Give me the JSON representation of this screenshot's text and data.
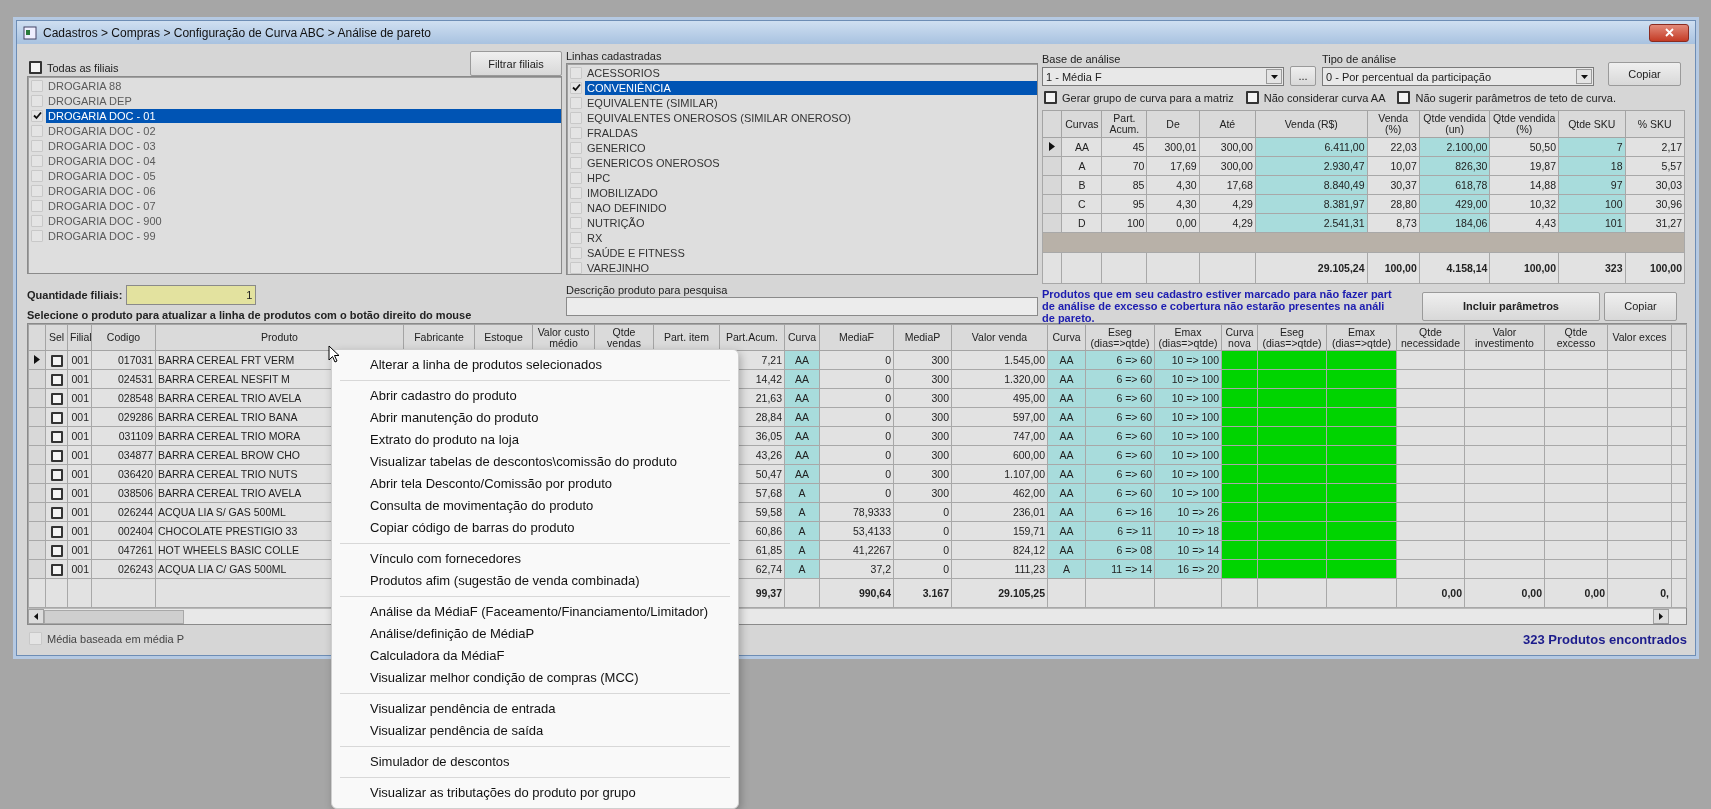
{
  "window": {
    "title": "Cadastros > Compras > Configuração de Curva ABC > Análise de pareto"
  },
  "filiais": {
    "all_label": "Todas as filiais",
    "all_checked": false,
    "filter_button": "Filtrar filiais",
    "items": [
      {
        "label": "DROGARIA 88",
        "checked": false,
        "selected": false
      },
      {
        "label": "DROGARIA DEP",
        "checked": false,
        "selected": false
      },
      {
        "label": "DROGARIA DOC - 01",
        "checked": true,
        "selected": true
      },
      {
        "label": "DROGARIA DOC - 02",
        "checked": false,
        "selected": false
      },
      {
        "label": "DROGARIA DOC - 03",
        "checked": false,
        "selected": false
      },
      {
        "label": "DROGARIA DOC - 04",
        "checked": false,
        "selected": false
      },
      {
        "label": "DROGARIA DOC - 05",
        "checked": false,
        "selected": false
      },
      {
        "label": "DROGARIA DOC - 06",
        "checked": false,
        "selected": false
      },
      {
        "label": "DROGARIA DOC - 07",
        "checked": false,
        "selected": false
      },
      {
        "label": "DROGARIA DOC - 900",
        "checked": false,
        "selected": false
      },
      {
        "label": "DROGARIA DOC - 99",
        "checked": false,
        "selected": false
      }
    ],
    "count_label": "Quantidade filiais:",
    "count_value": "1",
    "hint": "Selecione o produto para atualizar a linha de produtos com o botão direito do mouse"
  },
  "linhas": {
    "label": "Linhas cadastradas",
    "items": [
      {
        "label": "ACESSORIOS",
        "checked": false,
        "selected": false
      },
      {
        "label": "CONVENIÊNCIA",
        "checked": true,
        "selected": true
      },
      {
        "label": "EQUIVALENTE (SIMILAR)",
        "checked": false,
        "selected": false
      },
      {
        "label": "EQUIVALENTES ONEROSOS (SIMILAR ONEROSO)",
        "checked": false,
        "selected": false
      },
      {
        "label": "FRALDAS",
        "checked": false,
        "selected": false
      },
      {
        "label": "GENERICO",
        "checked": false,
        "selected": false
      },
      {
        "label": "GENERICOS ONEROSOS",
        "checked": false,
        "selected": false
      },
      {
        "label": "HPC",
        "checked": false,
        "selected": false
      },
      {
        "label": "IMOBILIZADO",
        "checked": false,
        "selected": false
      },
      {
        "label": "NAO DEFINIDO",
        "checked": false,
        "selected": false
      },
      {
        "label": "NUTRIÇÃO",
        "checked": false,
        "selected": false
      },
      {
        "label": "RX",
        "checked": false,
        "selected": false
      },
      {
        "label": "SAÚDE E FITNESS",
        "checked": false,
        "selected": false
      },
      {
        "label": "VAREJINHO",
        "checked": false,
        "selected": false
      }
    ],
    "search_label": "Descrição produto para pesquisa"
  },
  "analysis": {
    "base_label": "Base de análise",
    "base_value": "1 - Média F",
    "browse_button": "...",
    "tipo_label": "Tipo de análise",
    "tipo_value": "0 - Por percentual da participação",
    "copy_button": "Copiar",
    "options": [
      {
        "label": "Gerar grupo de curva para a matriz",
        "checked": false
      },
      {
        "label": "Não considerar curva AA",
        "checked": false
      },
      {
        "label": "Não sugerir parâmetros de teto de curva.",
        "checked": false
      }
    ]
  },
  "curves": {
    "columns": [
      "Curvas",
      "Part. Acum.",
      "De",
      "Até",
      "Venda (R$)",
      "Venda (%)",
      "Qtde vendida (un)",
      "Qtde vendida (%)",
      "Qtde SKU",
      "% SKU"
    ],
    "rows": [
      {
        "selected": true,
        "cells": [
          "AA",
          "45",
          "300,01",
          "300,00",
          "6.411,00",
          "22,03",
          "2.100,00",
          "50,50",
          "7",
          "2,17"
        ]
      },
      {
        "selected": false,
        "cells": [
          "A",
          "70",
          "17,69",
          "300,00",
          "2.930,47",
          "10,07",
          "826,30",
          "19,87",
          "18",
          "5,57"
        ]
      },
      {
        "selected": false,
        "cells": [
          "B",
          "85",
          "4,30",
          "17,68",
          "8.840,49",
          "30,37",
          "618,78",
          "14,88",
          "97",
          "30,03"
        ]
      },
      {
        "selected": false,
        "cells": [
          "C",
          "95",
          "4,30",
          "4,29",
          "8.381,97",
          "28,80",
          "429,00",
          "10,32",
          "100",
          "30,96"
        ]
      },
      {
        "selected": false,
        "cells": [
          "D",
          "100",
          "0,00",
          "4,29",
          "2.541,31",
          "8,73",
          "184,06",
          "4,43",
          "101",
          "31,27"
        ]
      }
    ],
    "totals": [
      "29.105,24",
      "100,00",
      "4.158,14",
      "100,00",
      "323",
      "100,00"
    ]
  },
  "notice": [
    "Produtos que em seu cadastro estiver marcado para não fazer part",
    "de análise de excesso e cobertura não estarão presentes na análi",
    "de pareto."
  ],
  "include_button": "Incluir parâmetros",
  "copy_button": "Copiar",
  "products": {
    "columns": [
      "Sel",
      "Filial",
      "Codigo",
      "Produto",
      "Fabricante",
      "Estoque",
      "Valor custo médio",
      "Qtde vendas",
      "Part. item",
      "Part.Acum.",
      "Curva",
      "MediaF",
      "MediaP",
      "Valor venda",
      "Curva",
      "Eseg (dias=>qtde)",
      "Emax (dias=>qtde)",
      "Curva nova",
      "Eseg (dias=>qtde)",
      "Emax (dias=>qtde)",
      "Qtde necessidade",
      "Valor investimento",
      "Qtde excesso",
      "Valor exces"
    ],
    "rows": [
      {
        "selected": true,
        "checked": false,
        "filial": "001",
        "codigo": "017031",
        "produto": "BARRA CEREAL FRT VERM",
        "part_acum": "7,21",
        "curva": "AA",
        "media_f": "0",
        "media_p": "300",
        "valor_venda": "1.545,00",
        "curva_estoque": "AA",
        "eseg": "6 => 60",
        "emax": "10 => 100"
      },
      {
        "selected": false,
        "checked": false,
        "filial": "001",
        "codigo": "024531",
        "produto": "BARRA CEREAL NESFIT M",
        "part_acum": "14,42",
        "curva": "AA",
        "media_f": "0",
        "media_p": "300",
        "valor_venda": "1.320,00",
        "curva_estoque": "AA",
        "eseg": "6 => 60",
        "emax": "10 => 100"
      },
      {
        "selected": false,
        "checked": false,
        "filial": "001",
        "codigo": "028548",
        "produto": "BARRA CEREAL TRIO AVELA",
        "part_acum": "21,63",
        "curva": "AA",
        "media_f": "0",
        "media_p": "300",
        "valor_venda": "495,00",
        "curva_estoque": "AA",
        "eseg": "6 => 60",
        "emax": "10 => 100"
      },
      {
        "selected": false,
        "checked": false,
        "filial": "001",
        "codigo": "029286",
        "produto": "BARRA CEREAL TRIO BANA",
        "part_acum": "28,84",
        "curva": "AA",
        "media_f": "0",
        "media_p": "300",
        "valor_venda": "597,00",
        "curva_estoque": "AA",
        "eseg": "6 => 60",
        "emax": "10 => 100"
      },
      {
        "selected": false,
        "checked": false,
        "filial": "001",
        "codigo": "031109",
        "produto": "BARRA CEREAL TRIO MORA",
        "part_acum": "36,05",
        "curva": "AA",
        "media_f": "0",
        "media_p": "300",
        "valor_venda": "747,00",
        "curva_estoque": "AA",
        "eseg": "6 => 60",
        "emax": "10 => 100"
      },
      {
        "selected": false,
        "checked": false,
        "filial": "001",
        "codigo": "034877",
        "produto": "BARRA CEREAL BROW CHO",
        "part_acum": "43,26",
        "curva": "AA",
        "media_f": "0",
        "media_p": "300",
        "valor_venda": "600,00",
        "curva_estoque": "AA",
        "eseg": "6 => 60",
        "emax": "10 => 100"
      },
      {
        "selected": false,
        "checked": false,
        "filial": "001",
        "codigo": "036420",
        "produto": "BARRA CEREAL TRIO NUTS",
        "part_acum": "50,47",
        "curva": "AA",
        "media_f": "0",
        "media_p": "300",
        "valor_venda": "1.107,00",
        "curva_estoque": "AA",
        "eseg": "6 => 60",
        "emax": "10 => 100"
      },
      {
        "selected": false,
        "checked": false,
        "filial": "001",
        "codigo": "038506",
        "produto": "BARRA CEREAL TRIO AVELA",
        "part_acum": "57,68",
        "curva": "A",
        "media_f": "0",
        "media_p": "300",
        "valor_venda": "462,00",
        "curva_estoque": "AA",
        "eseg": "6 => 60",
        "emax": "10 => 100"
      },
      {
        "selected": false,
        "checked": false,
        "filial": "001",
        "codigo": "026244",
        "produto": "ACQUA LIA S/ GAS 500ML",
        "part_acum": "59,58",
        "curva": "A",
        "media_f": "78,9333",
        "media_p": "0",
        "valor_venda": "236,01",
        "curva_estoque": "AA",
        "eseg": "6 => 16",
        "emax": "10 => 26"
      },
      {
        "selected": false,
        "checked": false,
        "filial": "001",
        "codigo": "002404",
        "produto": "CHOCOLATE PRESTIGIO 33",
        "part_acum": "60,86",
        "curva": "A",
        "media_f": "53,4133",
        "media_p": "0",
        "valor_venda": "159,71",
        "curva_estoque": "AA",
        "eseg": "6 => 11",
        "emax": "10 => 18"
      },
      {
        "selected": false,
        "checked": false,
        "filial": "001",
        "codigo": "047261",
        "produto": "HOT WHEELS BASIC COLLE",
        "part_acum": "61,85",
        "curva": "A",
        "media_f": "41,2267",
        "media_p": "0",
        "valor_venda": "824,12",
        "curva_estoque": "AA",
        "eseg": "6 => 08",
        "emax": "10 => 14"
      },
      {
        "selected": false,
        "checked": false,
        "filial": "001",
        "codigo": "026243",
        "produto": "ACQUA LIA C/ GAS 500ML",
        "part_acum": "62,74",
        "curva": "A",
        "media_f": "37,2",
        "media_p": "0",
        "valor_venda": "111,23",
        "curva_estoque": "A",
        "eseg": "11 => 14",
        "emax": "16 => 20"
      }
    ],
    "totals": {
      "part_acum": "99,37",
      "media_f": "990,64",
      "media_p": "3.167",
      "valor_venda": "29.105,25",
      "qtde_necessidade": "0,00",
      "valor_investimento": "0,00",
      "qtde_excesso": "0,00",
      "valor_excesso": "0,"
    }
  },
  "footer": {
    "media_label": "Média baseada em média P",
    "media_checked": false,
    "count": "323 Produtos encontrados"
  },
  "context_menu": {
    "groups": [
      [
        "Alterar a linha de produtos selecionados"
      ],
      [
        "Abrir cadastro do produto",
        "Abrir manutenção do produto",
        "Extrato do produto na loja",
        "Visualizar tabelas de descontos\\comissão do produto",
        "Abrir tela Desconto/Comissão por produto",
        "Consulta de movimentação do produto",
        "Copiar código de barras do produto"
      ],
      [
        "Vínculo com fornecedores",
        "Produtos afim (sugestão de venda combinada)"
      ],
      [
        "Análise da MédiaF (Faceamento/Financiamento/Limitador)",
        "Análise/definição de MédiaP",
        "Calculadora da MédiaF",
        "Visualizar melhor condição de compras (MCC)"
      ],
      [
        "Visualizar pendência de entrada",
        "Visualizar pendência de saída"
      ],
      [
        "Simulador de descontos"
      ],
      [
        "Visualizar as tributações do produto por grupo"
      ]
    ]
  }
}
